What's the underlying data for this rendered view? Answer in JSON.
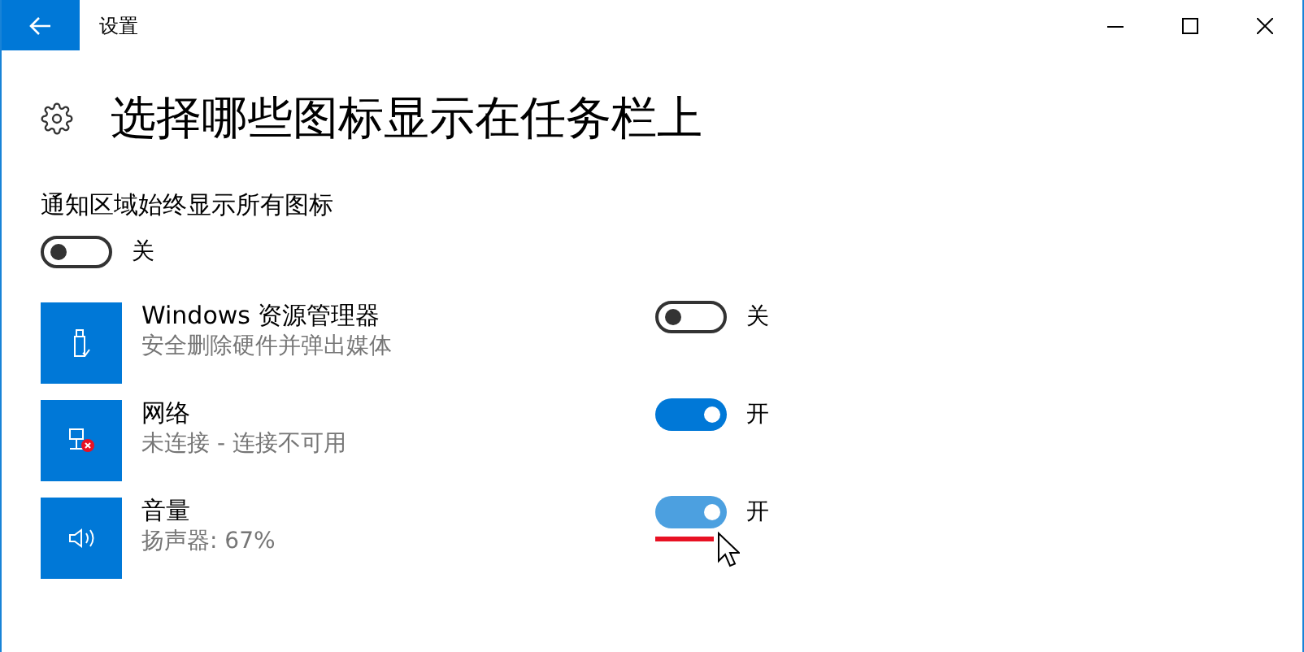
{
  "window": {
    "title": "设置"
  },
  "heading": "选择哪些图标显示在任务栏上",
  "always_show": {
    "label": "通知区域始终显示所有图标",
    "on": false,
    "state_text": "关"
  },
  "items": [
    {
      "kind": "usb",
      "name": "Windows 资源管理器",
      "description": "安全删除硬件并弹出媒体",
      "on": false,
      "state_text": "关",
      "hovered": false,
      "underlined": false
    },
    {
      "kind": "network",
      "name": "网络",
      "description": "未连接 - 连接不可用",
      "on": true,
      "state_text": "开",
      "hovered": false,
      "underlined": false
    },
    {
      "kind": "speaker",
      "name": "音量",
      "description": "扬声器: 67%",
      "on": true,
      "state_text": "开",
      "hovered": true,
      "underlined": true
    }
  ]
}
